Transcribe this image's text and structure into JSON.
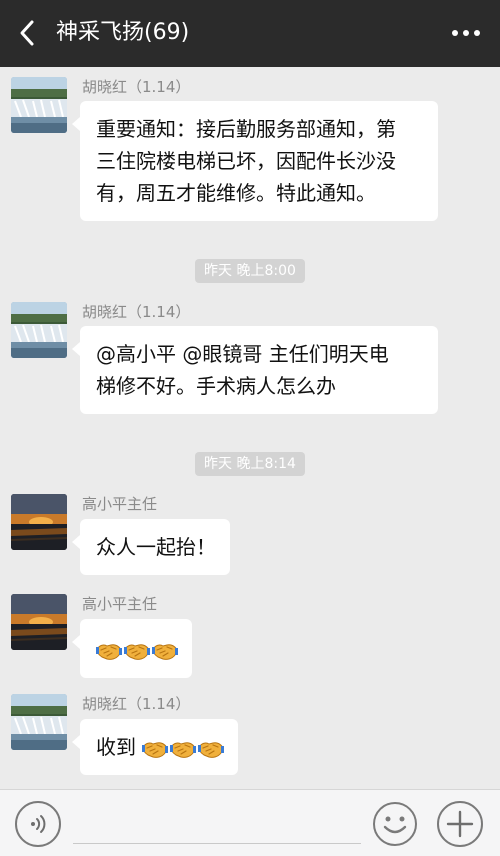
{
  "header": {
    "back_icon": "chevron-left-icon",
    "title": "神采飞扬(69)",
    "more_icon": "more-dots-icon"
  },
  "messages": [
    {
      "sender": "胡晓红（1.14）",
      "avatar": "waterfall-avatar",
      "lines": [
        "重要通知：接后勤服务部通知，第",
        "三住院楼电梯已坏，因配件长沙没",
        "有，周五才能维修。特此通知。"
      ]
    },
    {
      "time": "昨天 晚上8:00"
    },
    {
      "sender": "胡晓红（1.14）",
      "avatar": "waterfall-avatar",
      "lines": [
        "@高小平 @眼镜哥  主任们明天电",
        "梯修不好。手术病人怎么办"
      ]
    },
    {
      "time": "昨天 晚上8:14"
    },
    {
      "sender": "高小平主任",
      "avatar": "sunset-avatar",
      "text": "众人一起抬！"
    },
    {
      "sender": "高小平主任",
      "avatar": "sunset-avatar",
      "emoji": [
        "handshake-icon",
        "handshake-icon",
        "handshake-icon"
      ]
    },
    {
      "sender": "胡晓红（1.14）",
      "avatar": "waterfall-avatar",
      "text": "收到",
      "emoji": [
        "handshake-icon",
        "handshake-icon",
        "handshake-icon"
      ]
    }
  ],
  "input_bar": {
    "voice_icon": "voice-icon",
    "input_value": "",
    "emoji_icon": "emoji-smile-icon",
    "plus_icon": "plus-icon"
  },
  "colors": {
    "header_bg": "#2b2b2b",
    "chat_bg": "#ebebeb",
    "bubble_bg": "#ffffff",
    "time_badge_bg": "#d3d3d3"
  }
}
